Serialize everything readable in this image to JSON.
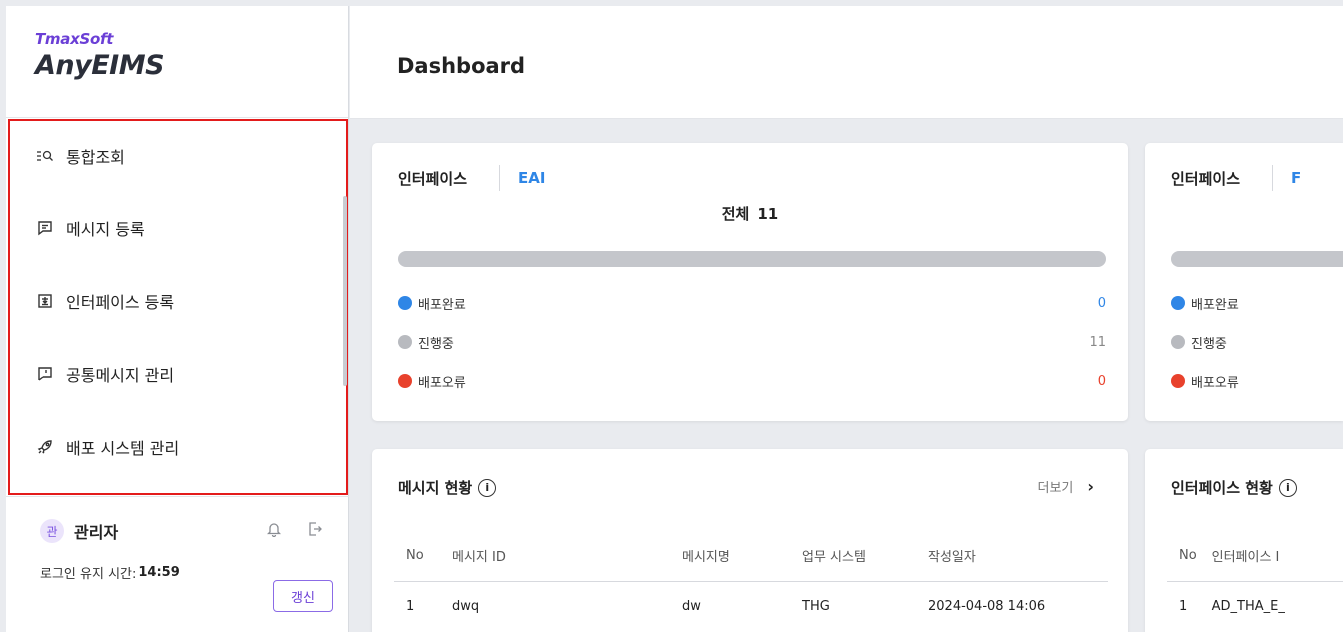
{
  "brand": {
    "company": "TmaxSoft",
    "product": "AnyEIMS"
  },
  "sidebar": {
    "items": [
      {
        "label": "통합조회",
        "icon": "search-list-icon"
      },
      {
        "label": "메시지 등록",
        "icon": "message-icon"
      },
      {
        "label": "인터페이스 등록",
        "icon": "interface-icon"
      },
      {
        "label": "공통메시지 관리",
        "icon": "flag-icon"
      },
      {
        "label": "배포 시스템 관리",
        "icon": "rocket-icon"
      }
    ]
  },
  "user": {
    "avatar_text": "관",
    "name": "관리자",
    "session_label": "로그인 유지 시간:",
    "session_time": "14:59",
    "renew_label": "갱신"
  },
  "header": {
    "title": "Dashboard"
  },
  "cards": {
    "eai": {
      "tab_label": "인터페이스",
      "tab_link": "EAI",
      "total_label": "전체",
      "total_value": "11",
      "legend": [
        {
          "label": "배포완료",
          "value": "0",
          "color": "#2f86e6"
        },
        {
          "label": "진행중",
          "value": "11",
          "color": "#b8babf"
        },
        {
          "label": "배포오류",
          "value": "0",
          "color": "#e8412c"
        }
      ]
    },
    "fep": {
      "tab_label": "인터페이스",
      "tab_link": "F",
      "legend": [
        {
          "label": "배포완료",
          "color": "#2f86e6"
        },
        {
          "label": "진행중",
          "color": "#b8babf"
        },
        {
          "label": "배포오류",
          "color": "#e8412c"
        }
      ]
    }
  },
  "messages": {
    "title": "메시지 현황",
    "more_label": "더보기",
    "columns": [
      "No",
      "메시지 ID",
      "메시지명",
      "업무 시스템",
      "작성일자"
    ],
    "rows": [
      [
        "1",
        "dwq",
        "dw",
        "THG",
        "2024-04-08 14:06"
      ]
    ]
  },
  "interfaces": {
    "title": "인터페이스 현황",
    "columns": [
      "No",
      "인터페이스 I"
    ],
    "rows": [
      [
        "1",
        "AD_THA_E_"
      ]
    ]
  },
  "colors": {
    "accent": "#6b3fd6",
    "link": "#2f86e6",
    "error": "#e8412c",
    "highlight": "#e31b1b"
  }
}
